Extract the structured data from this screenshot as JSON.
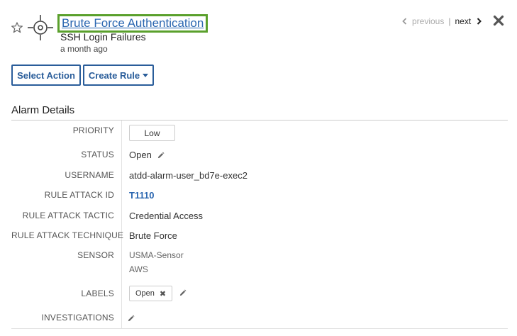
{
  "header": {
    "title": "Brute Force Authentication",
    "subtitle": "SSH Login Failures",
    "time_ago": "a month ago"
  },
  "pager": {
    "previous_label": "previous",
    "separator": "|",
    "next_label": "next"
  },
  "actions": {
    "select_action_label": "Select Action",
    "create_rule_label": "Create Rule"
  },
  "section": {
    "title": "Alarm Details"
  },
  "details": {
    "priority_label": "PRIORITY",
    "priority_value": "Low",
    "status_label": "STATUS",
    "status_value": "Open",
    "username_label": "USERNAME",
    "username_value": "atdd-alarm-user_bd7e-exec2",
    "rule_attack_id_label": "RULE ATTACK ID",
    "rule_attack_id_value": "T1110",
    "rule_attack_tactic_label": "RULE ATTACK TACTIC",
    "rule_attack_tactic_value": "Credential Access",
    "rule_attack_technique_label": "RULE ATTACK TECHNIQUE",
    "rule_attack_technique_value": "Brute Force",
    "sensor_label": "SENSOR",
    "sensor_values": [
      "USMA-Sensor",
      "AWS"
    ],
    "labels_label": "LABELS",
    "labels_chip": "Open",
    "investigations_label": "INVESTIGATIONS"
  },
  "colors": {
    "title_link": "#2a66b0",
    "highlight_border": "#5aa02c",
    "button_border": "#2a5d9a"
  },
  "icons": {
    "star": "star-icon",
    "target": "crosshair-icon",
    "pencil": "pencil-icon",
    "close": "close-icon",
    "chevron_left": "chevron-left-icon",
    "chevron_right": "chevron-right-icon"
  }
}
